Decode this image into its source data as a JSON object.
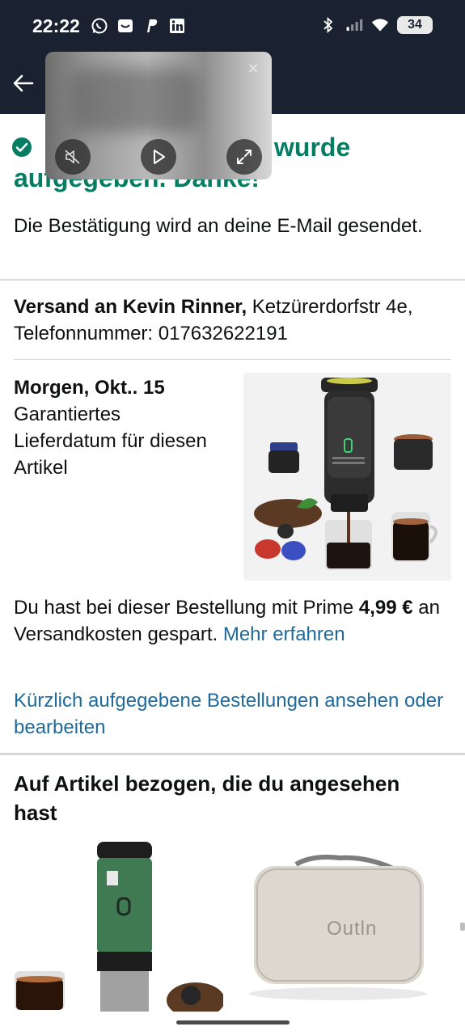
{
  "status_bar": {
    "time": "22:22",
    "battery": "34",
    "left_icons": [
      "whatsapp-icon",
      "mail-icon",
      "paypal-icon",
      "linkedin-icon"
    ],
    "right_icons": [
      "bluetooth-icon",
      "signal-icon",
      "wifi-icon",
      "battery-icon"
    ]
  },
  "header": {
    "back_icon": "arrow-left-icon"
  },
  "video_pip": {
    "controls": [
      "mute-icon",
      "play-icon",
      "expand-icon",
      "close-icon"
    ]
  },
  "confirmation": {
    "headline_line1": "wurde",
    "headline_line2": "aufgegeben. Danke!",
    "email_note": "Die Bestätigung wird an deine E-Mail gesendet."
  },
  "shipping": {
    "label": "Versand an Kevin Rinner,",
    "address": " Ketzürerdorfstr 4e, Telefonnummer: 017632622191"
  },
  "delivery": {
    "date": "Morgen, Okt.. 15",
    "description": "Garantiertes Lieferdatum für diesen Artikel"
  },
  "prime": {
    "text_before": "Du hast bei dieser Bestellung mit Prime ",
    "amount": "4,99 €",
    "text_after": " an Versandkosten gespart. ",
    "link": "Mehr erfahren"
  },
  "orders_link": "Kürzlich aufgegebene Bestellungen ansehen oder bearbeiten",
  "recommendations": {
    "title": "Auf Artikel bezogen, die du angesehen hast",
    "case_logo": "Outln"
  },
  "colors": {
    "header_bg": "#1a2231",
    "success_green": "#067d62",
    "link_blue": "#1f6a9b",
    "divider": "#d5d9d9"
  }
}
